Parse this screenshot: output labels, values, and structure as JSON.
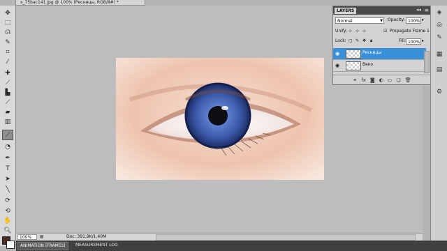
{
  "document": {
    "tab_title": "x_75bac141.jpg @ 100% (Ресницы, RGB/8#) *",
    "zoom": "100%",
    "doc_info": "Doc: 391,9K/1,40M"
  },
  "bottom_tabs": [
    "ANIMATION (FRAMES)",
    "MEASUREMENT LOG"
  ],
  "layers_panel": {
    "tab_label": "LAYERS",
    "collapse": "◂◂",
    "menu": "≡",
    "blend_mode": "Normal",
    "opacity_label": "Opacity:",
    "opacity_value": "100%",
    "unify_label": "Unify:",
    "propagate_label": "Propagate Frame 1",
    "lock_label": "Lock:",
    "fill_label": "Fill:",
    "fill_value": "100%",
    "layers": [
      {
        "name": "Ресницы",
        "selected": true
      },
      {
        "name": "Веко",
        "selected": false
      }
    ],
    "footer_icons": [
      "link-icon",
      "fx-icon",
      "mask-icon",
      "adjustment-icon",
      "group-icon",
      "new-layer-icon",
      "trash-icon"
    ]
  },
  "toolbar": {
    "tools": [
      "move",
      "marquee",
      "lasso",
      "quick-select",
      "crop",
      "eyedropper",
      "healing",
      "brush",
      "stamp",
      "history-brush",
      "eraser",
      "gradient",
      "dodge",
      "pen",
      "text",
      "path-select",
      "shape",
      "3d-rotate",
      "3d-orbit",
      "hand",
      "zoom"
    ],
    "active_tool": "healing",
    "foreground_color": "#4a2c25",
    "background_color": "#ffffff"
  },
  "colors": {
    "selected_layer": "#3a8fd9",
    "iris": "#3b58a8",
    "skin": "#e8b8a2"
  }
}
